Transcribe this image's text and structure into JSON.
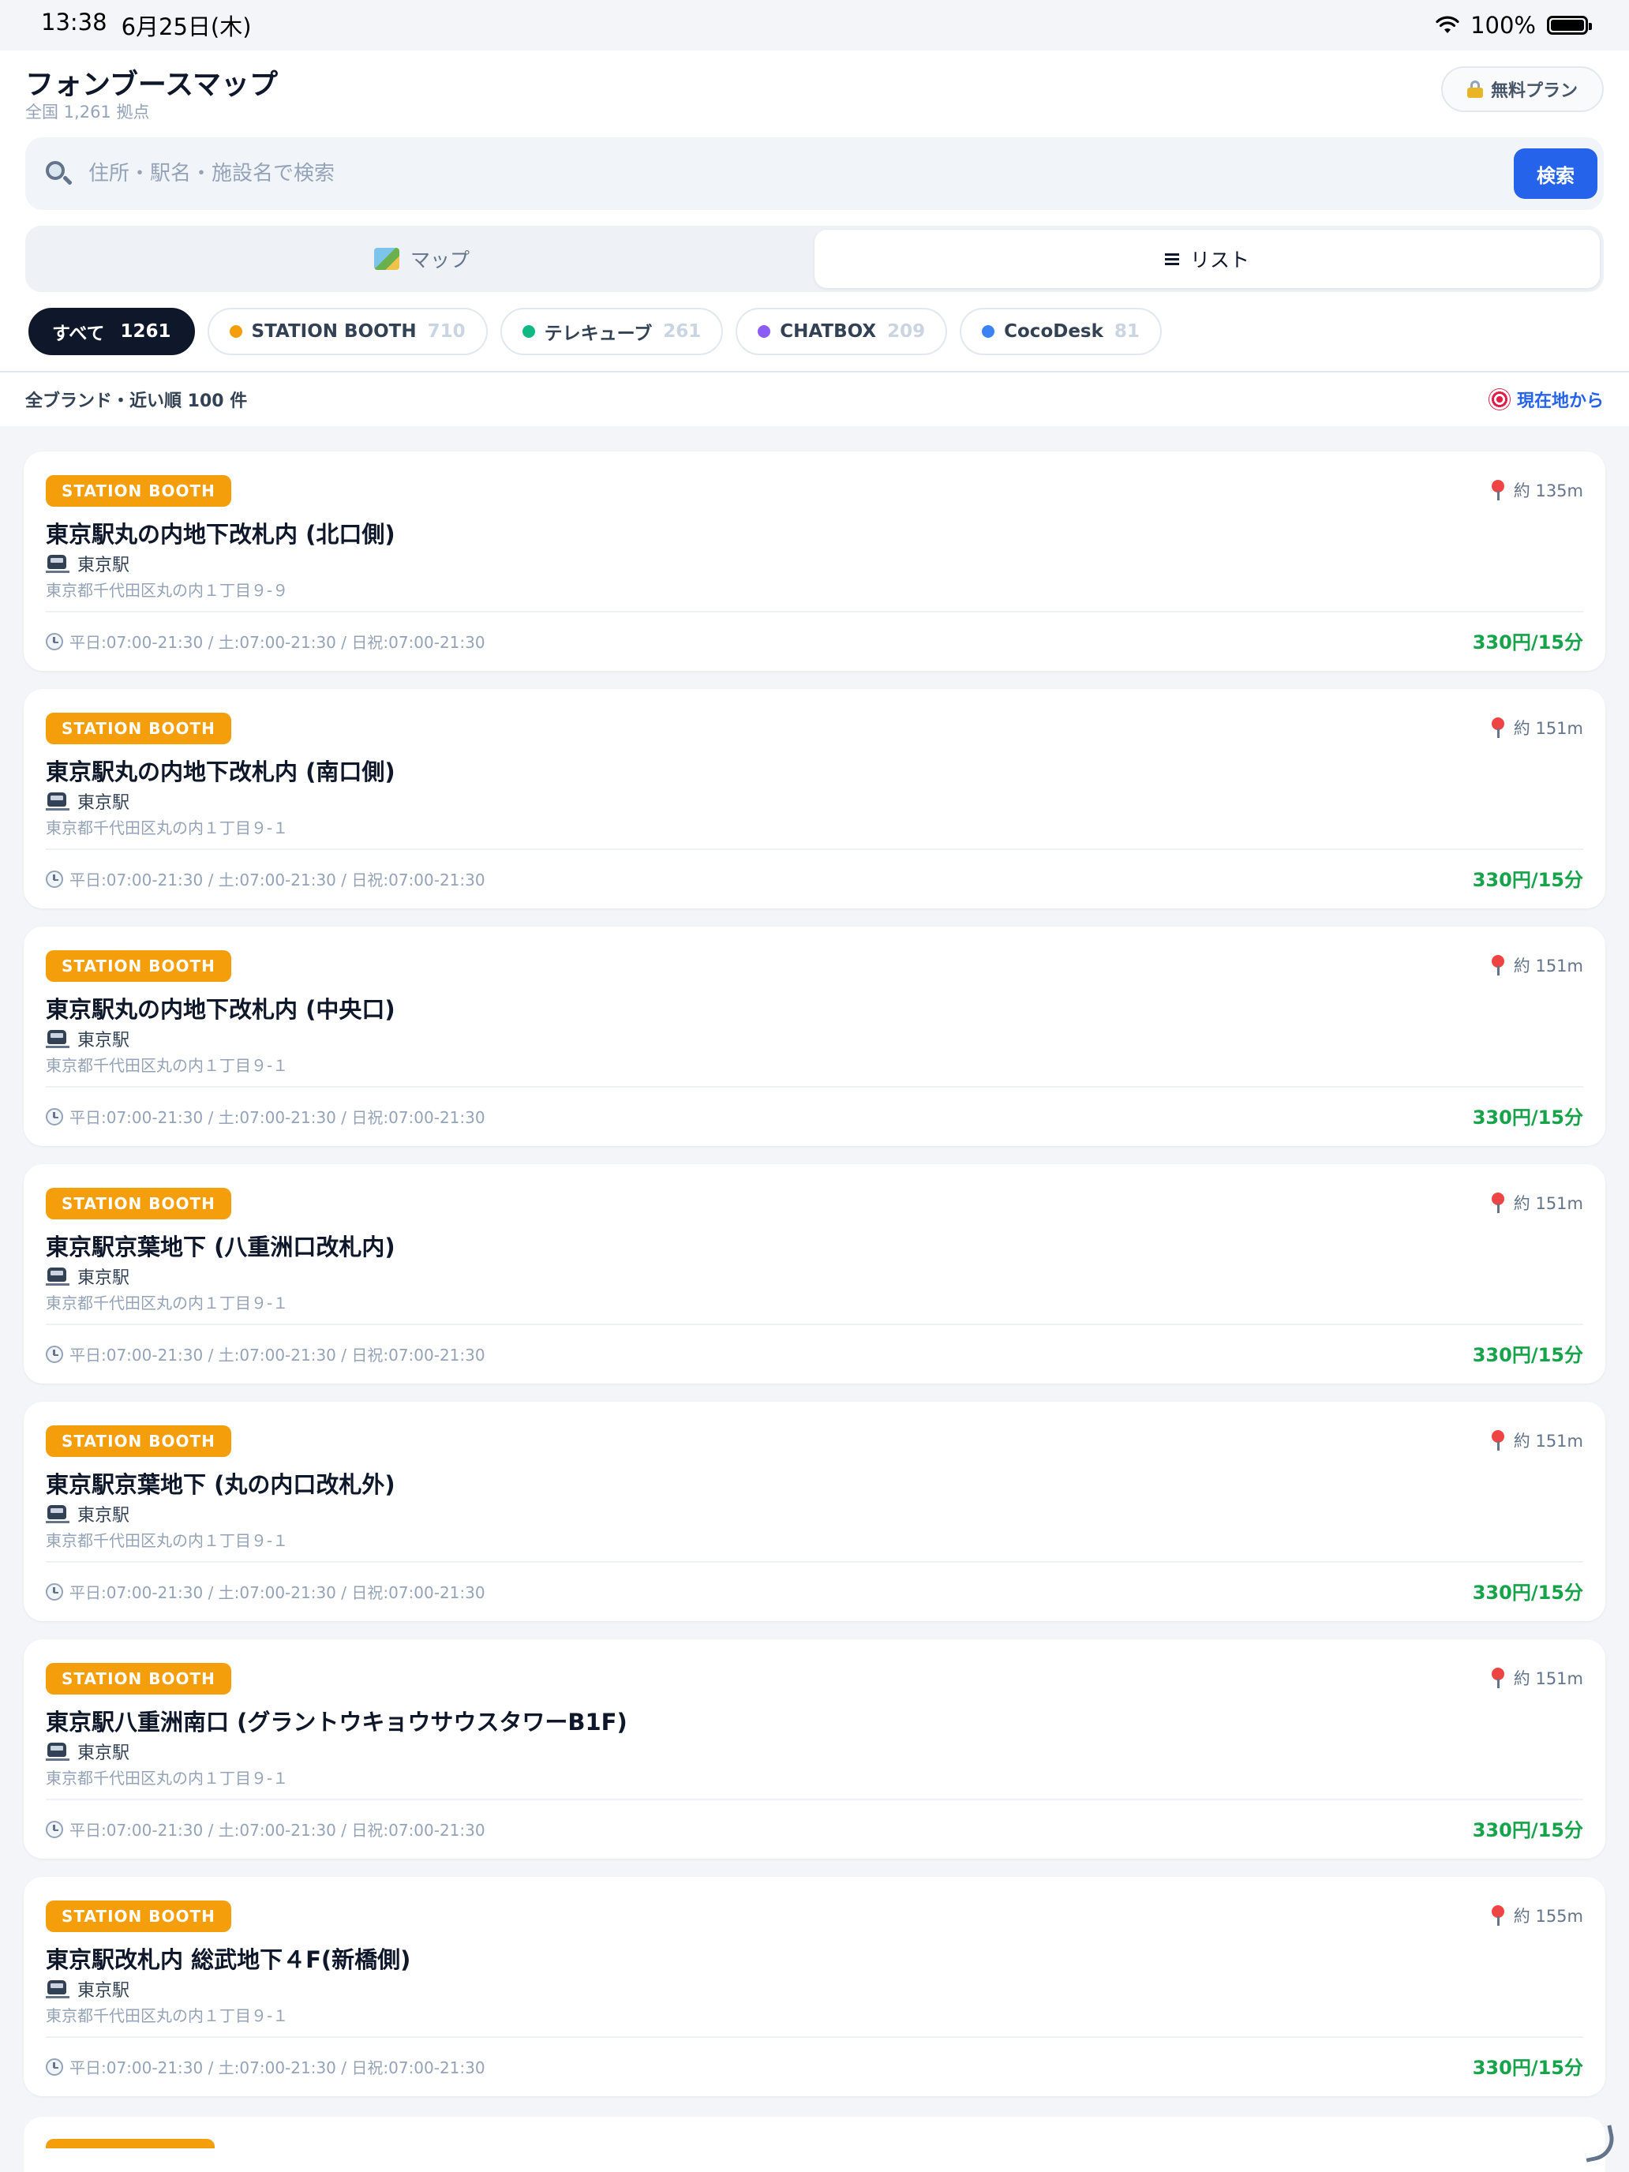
{
  "status_bar": {
    "time": "13:38",
    "date": "6月25日(木)",
    "battery": "100%"
  },
  "header": {
    "title": "フォンブースマップ",
    "subtitle": "全国 1,261 拠点",
    "plan_label": "無料プラン"
  },
  "search": {
    "placeholder": "住所・駅名・施設名で検索",
    "value": "",
    "button_label": "検索"
  },
  "view_tabs": [
    {
      "label": "マップ",
      "icon": "map-icon",
      "active": false
    },
    {
      "label": "リスト",
      "icon": "list-icon",
      "active": true
    }
  ],
  "filters": [
    {
      "label": "すべて",
      "count": "1261",
      "active": true
    },
    {
      "label": "STATION BOOTH",
      "count": "710",
      "color": "#f59e0b"
    },
    {
      "label": "テレキューブ",
      "count": "261",
      "color": "#10b981"
    },
    {
      "label": "CHATBOX",
      "count": "209",
      "color": "#8b5cf6"
    },
    {
      "label": "CocoDesk",
      "count": "81",
      "color": "#3b82f6"
    }
  ],
  "sort": {
    "label": "全ブランド・近い順 100 件",
    "locate_label": "現在地から"
  },
  "cards": [
    {
      "brand": "STATION BOOTH",
      "distance": "約 135m",
      "title": "東京駅丸の内地下改札内 (北口側)",
      "station": "東京駅",
      "address": "東京都千代田区丸の内１丁目９-９",
      "hours": "平日:07:00-21:30 / 土:07:00-21:30 / 日祝:07:00-21:30",
      "price": "330円/15分"
    },
    {
      "brand": "STATION BOOTH",
      "distance": "約 151m",
      "title": "東京駅丸の内地下改札内 (南口側)",
      "station": "東京駅",
      "address": "東京都千代田区丸の内１丁目９-１",
      "hours": "平日:07:00-21:30 / 土:07:00-21:30 / 日祝:07:00-21:30",
      "price": "330円/15分"
    },
    {
      "brand": "STATION BOOTH",
      "distance": "約 151m",
      "title": "東京駅丸の内地下改札内 (中央口)",
      "station": "東京駅",
      "address": "東京都千代田区丸の内１丁目９-１",
      "hours": "平日:07:00-21:30 / 土:07:00-21:30 / 日祝:07:00-21:30",
      "price": "330円/15分"
    },
    {
      "brand": "STATION BOOTH",
      "distance": "約 151m",
      "title": "東京駅京葉地下 (八重洲口改札内)",
      "station": "東京駅",
      "address": "東京都千代田区丸の内１丁目９-１",
      "hours": "平日:07:00-21:30 / 土:07:00-21:30 / 日祝:07:00-21:30",
      "price": "330円/15分"
    },
    {
      "brand": "STATION BOOTH",
      "distance": "約 151m",
      "title": "東京駅京葉地下 (丸の内口改札外)",
      "station": "東京駅",
      "address": "東京都千代田区丸の内１丁目９-１",
      "hours": "平日:07:00-21:30 / 土:07:00-21:30 / 日祝:07:00-21:30",
      "price": "330円/15分"
    },
    {
      "brand": "STATION BOOTH",
      "distance": "約 151m",
      "title": "東京駅八重洲南口 (グラントウキョウサウスタワーB1F)",
      "station": "東京駅",
      "address": "東京都千代田区丸の内１丁目９-１",
      "hours": "平日:07:00-21:30 / 土:07:00-21:30 / 日祝:07:00-21:30",
      "price": "330円/15分"
    },
    {
      "brand": "STATION BOOTH",
      "distance": "約 155m",
      "title": "東京駅改札内 総武地下４F(新橋側)",
      "station": "東京駅",
      "address": "東京都千代田区丸の内１丁目９-１",
      "hours": "平日:07:00-21:30 / 土:07:00-21:30 / 日祝:07:00-21:30",
      "price": "330円/15分"
    }
  ]
}
